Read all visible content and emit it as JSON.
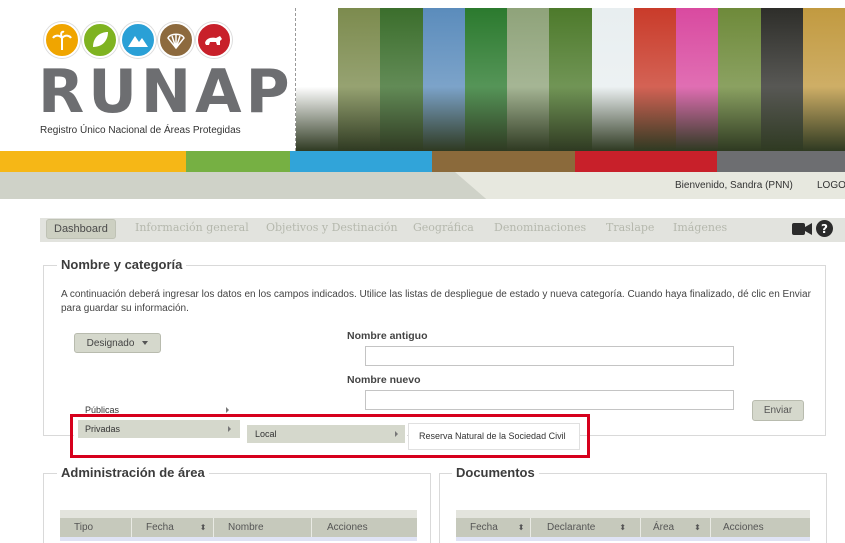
{
  "header": {
    "logo_text": "RUNAP",
    "logo_subtitle": "Registro Único Nacional de Áreas Protegidas",
    "logo_icon_colors": [
      "#f0a500",
      "#7fb321",
      "#2aa0d6",
      "#8d6a3e",
      "#c8202a"
    ],
    "banner_strip_colors": [
      "#ffffff",
      "#7c8b4e",
      "#3b6e2c",
      "#5b8cbc",
      "#2b7a2e",
      "#8fa37a",
      "#4d7a2b",
      "#e8eef0",
      "#c93b2a",
      "#d94aa0",
      "#6e8a3a",
      "#2e2e2a",
      "#c29a40"
    ],
    "color_bar": [
      "#f6b716",
      "#76b043",
      "#31a4d9",
      "#8b6a3b",
      "#c8202a",
      "#6d6e71"
    ]
  },
  "welcome": {
    "text": "Bienvenido, Sandra (PNN)",
    "logout": "LOGOU"
  },
  "nav": {
    "tabs": [
      "Dashboard",
      "Información general",
      "Objetivos y Destinación",
      "Geográfica",
      "Denominaciones",
      "Traslape",
      "Imágenes"
    ],
    "icons": [
      "video-camera-icon",
      "help-icon"
    ]
  },
  "section_nombre": {
    "legend": "Nombre y categoría",
    "instructions": "A continuación deberá ingresar los datos en los campos indicados. Utilice las listas de despliegue de estado y nueva categoría. Cuando haya finalizado, dé clic en Enviar para guardar su información.",
    "designado_button": "Designado",
    "nombre_antiguo_label": "Nombre antiguo",
    "nombre_antiguo_value": "",
    "nombre_nuevo_label": "Nombre nuevo",
    "nombre_nuevo_value": "",
    "enviar_button": "Enviar"
  },
  "dropdown": {
    "level1": [
      "Públicas",
      "Privadas"
    ],
    "level2": [
      "Local"
    ],
    "level3": [
      "Reserva Natural de la Sociedad Civil"
    ]
  },
  "section_admin": {
    "legend": "Administración de área",
    "columns": [
      "Tipo",
      "Fecha",
      "Nombre",
      "Acciones"
    ]
  },
  "section_docs": {
    "legend": "Documentos",
    "columns": [
      "Fecha",
      "Declarante",
      "Área",
      "Acciones"
    ]
  }
}
